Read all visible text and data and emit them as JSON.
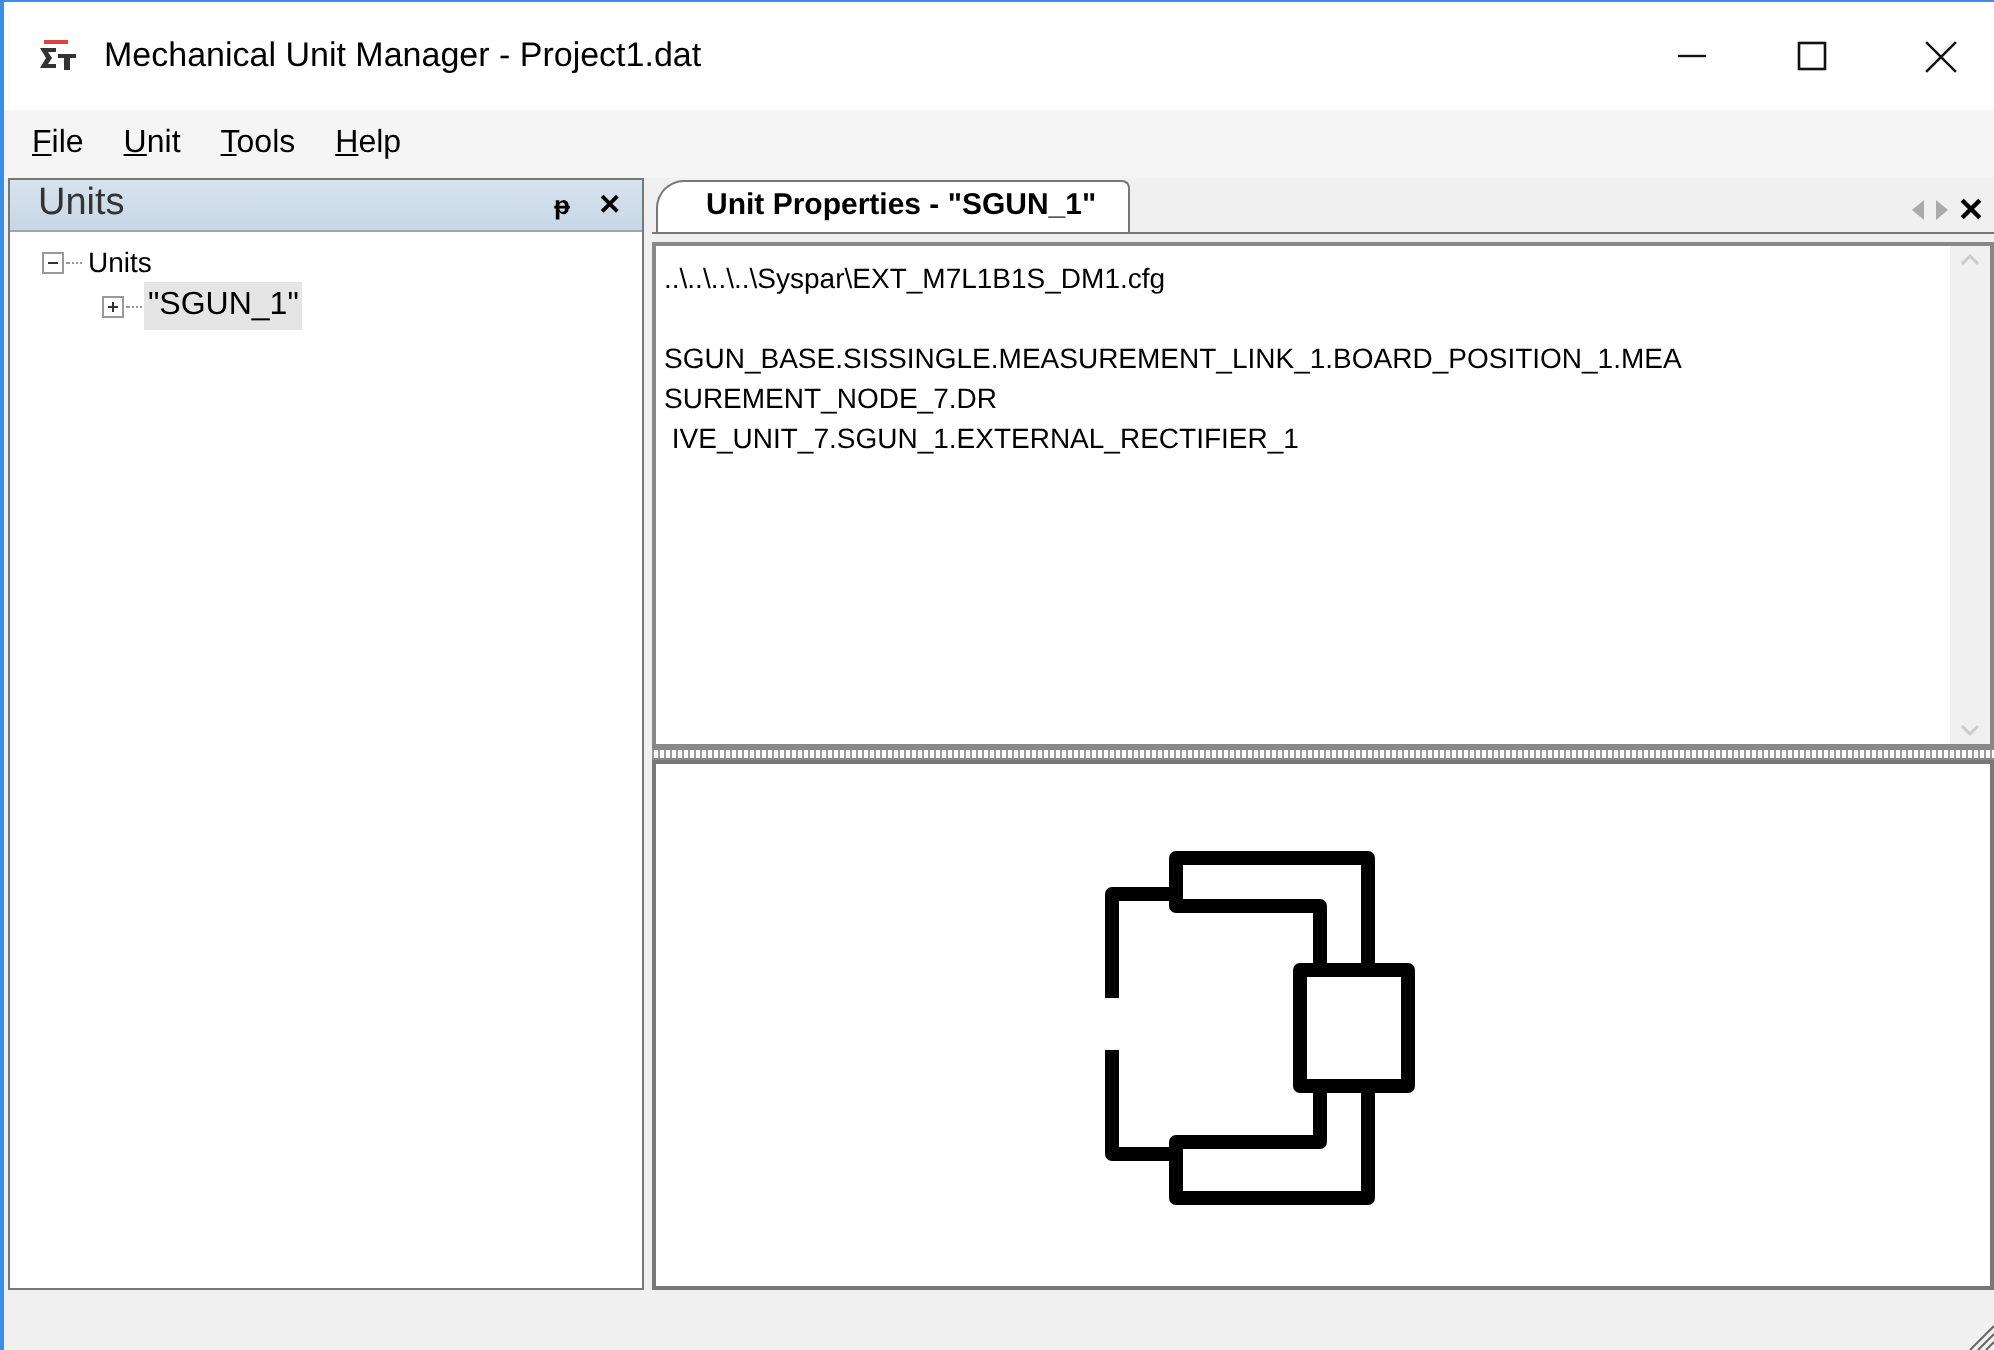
{
  "window": {
    "title": "Mechanical Unit Manager - Project1.dat"
  },
  "menu": [
    "File",
    "Unit",
    "Tools",
    "Help"
  ],
  "units_panel": {
    "title": "Units",
    "pin": "ᵽ",
    "close": "✕",
    "tree": [
      {
        "label": "Units",
        "expanded": true,
        "selected": false,
        "children": [
          {
            "label": "\"SGUN_1\"",
            "expanded": false,
            "selected": true
          }
        ]
      }
    ]
  },
  "document": {
    "tabs": [
      {
        "label": "Unit Properties - \"SGUN_1\"",
        "selected": true
      }
    ],
    "file_path": "..\\..\\..\\..\\Syspar\\EXT_M7L1B1S_DM1.cfg",
    "lines": [
      "SGUN_BASE.SISSINGLE.MEASUREMENT_LINK_1.BOARD_POSITION_1.MEA",
      "SUREMENT_NODE_7.DR",
      " IVE_UNIT_7.SGUN_1.EXTERNAL_RECTIFIER_1"
    ]
  }
}
